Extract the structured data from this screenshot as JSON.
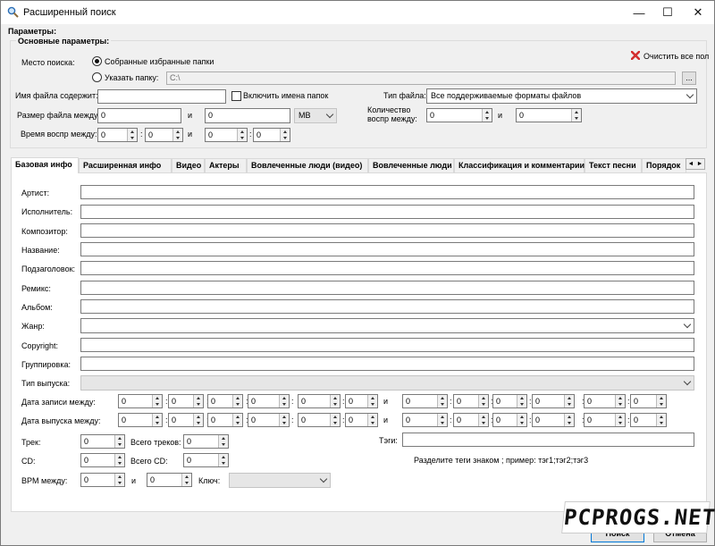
{
  "window": {
    "title": "Расширенный поиск",
    "minimize": "—",
    "maximize": "☐",
    "close": "✕"
  },
  "params": {
    "heading": "Параметры:",
    "main_heading": "Основные параметры:",
    "search_location_label": "Место поиска:",
    "radio_favorites": "Собранные избранные папки",
    "radio_folder": "Указать папку:",
    "folder_value": "C:\\",
    "browse_label": "...",
    "clear_all": "Очистить все пол",
    "filename_label": "Имя файла содержит:",
    "filename_value": "",
    "include_folders": "Включить имена папок",
    "filetype_label": "Тип файла:",
    "filetype_value": "Все поддерживаемые форматы файлов",
    "filesize_label": "Размер файла между:",
    "size_from": "0",
    "and1": "и",
    "size_to": "0",
    "size_unit": "MB",
    "playcount_label_1": "Количество",
    "playcount_label_2": "воспр между:",
    "play_from": "0",
    "and2": "и",
    "play_to": "0",
    "playtime_label": "Время воспр между:",
    "time_from_m": "0",
    "colon1": ":",
    "time_from_s": "0",
    "and3": "и",
    "time_to_m": "0",
    "colon2": ":",
    "time_to_s": "0"
  },
  "tabs": [
    "Базовая инфо",
    "Расширенная инфо",
    "Видео",
    "Актеры",
    "Вовлеченные люди (видео)",
    "Вовлеченные люди",
    "Классификация и комментарии",
    "Текст песни",
    "Порядок"
  ],
  "tab_scroll": {
    "left": "◄",
    "right": "►"
  },
  "basic": {
    "artist": "Артист:",
    "performer": "Исполнитель:",
    "composer": "Композитор:",
    "title": "Название:",
    "subtitle": "Подзаголовок:",
    "remix": "Ремикс:",
    "album": "Альбом:",
    "genre": "Жанр:",
    "copyright": "Copyright:",
    "grouping": "Группировка:",
    "release_type": "Тип выпуска:",
    "record_date": "Дата записи между:",
    "release_date": "Дата выпуска между:",
    "zero": "0",
    "colon": ":",
    "and": "и",
    "track": "Трек:",
    "total_tracks": "Всего треков:",
    "cd": "CD:",
    "total_cd": "Всего CD:",
    "bpm": "BPM между:",
    "key": "Ключ:",
    "tags": "Тэги:",
    "tags_hint": "Разделите теги знаком ; пример: тэг1;тэг2;тэг3"
  },
  "buttons": {
    "search": "Поиск",
    "cancel": "Отмена"
  },
  "watermark": "PCPROGS.NET",
  "colors": {
    "accent": "#0078d7",
    "clear_icon": "#d32f2f"
  }
}
